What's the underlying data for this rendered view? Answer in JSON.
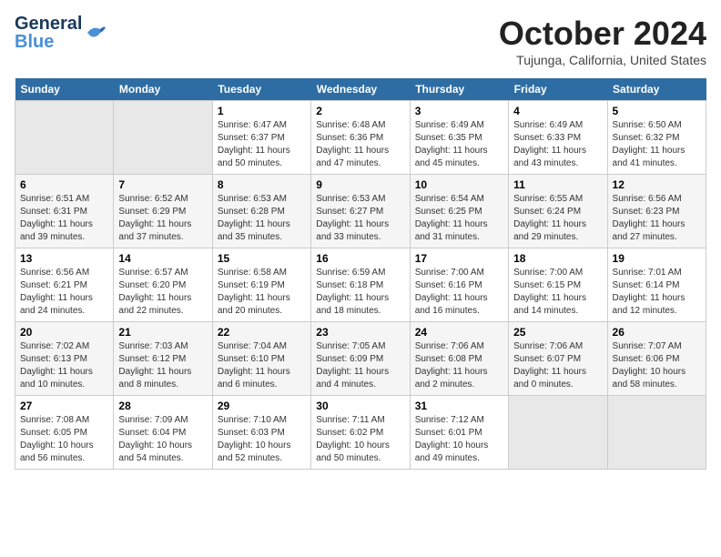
{
  "header": {
    "logo_general": "General",
    "logo_blue": "Blue",
    "month": "October 2024",
    "location": "Tujunga, California, United States"
  },
  "weekdays": [
    "Sunday",
    "Monday",
    "Tuesday",
    "Wednesday",
    "Thursday",
    "Friday",
    "Saturday"
  ],
  "weeks": [
    [
      {
        "day": "",
        "empty": true
      },
      {
        "day": "",
        "empty": true
      },
      {
        "day": "1",
        "sunrise": "6:47 AM",
        "sunset": "6:37 PM",
        "daylight": "11 hours and 50 minutes."
      },
      {
        "day": "2",
        "sunrise": "6:48 AM",
        "sunset": "6:36 PM",
        "daylight": "11 hours and 47 minutes."
      },
      {
        "day": "3",
        "sunrise": "6:49 AM",
        "sunset": "6:35 PM",
        "daylight": "11 hours and 45 minutes."
      },
      {
        "day": "4",
        "sunrise": "6:49 AM",
        "sunset": "6:33 PM",
        "daylight": "11 hours and 43 minutes."
      },
      {
        "day": "5",
        "sunrise": "6:50 AM",
        "sunset": "6:32 PM",
        "daylight": "11 hours and 41 minutes."
      }
    ],
    [
      {
        "day": "6",
        "sunrise": "6:51 AM",
        "sunset": "6:31 PM",
        "daylight": "11 hours and 39 minutes."
      },
      {
        "day": "7",
        "sunrise": "6:52 AM",
        "sunset": "6:29 PM",
        "daylight": "11 hours and 37 minutes."
      },
      {
        "day": "8",
        "sunrise": "6:53 AM",
        "sunset": "6:28 PM",
        "daylight": "11 hours and 35 minutes."
      },
      {
        "day": "9",
        "sunrise": "6:53 AM",
        "sunset": "6:27 PM",
        "daylight": "11 hours and 33 minutes."
      },
      {
        "day": "10",
        "sunrise": "6:54 AM",
        "sunset": "6:25 PM",
        "daylight": "11 hours and 31 minutes."
      },
      {
        "day": "11",
        "sunrise": "6:55 AM",
        "sunset": "6:24 PM",
        "daylight": "11 hours and 29 minutes."
      },
      {
        "day": "12",
        "sunrise": "6:56 AM",
        "sunset": "6:23 PM",
        "daylight": "11 hours and 27 minutes."
      }
    ],
    [
      {
        "day": "13",
        "sunrise": "6:56 AM",
        "sunset": "6:21 PM",
        "daylight": "11 hours and 24 minutes."
      },
      {
        "day": "14",
        "sunrise": "6:57 AM",
        "sunset": "6:20 PM",
        "daylight": "11 hours and 22 minutes."
      },
      {
        "day": "15",
        "sunrise": "6:58 AM",
        "sunset": "6:19 PM",
        "daylight": "11 hours and 20 minutes."
      },
      {
        "day": "16",
        "sunrise": "6:59 AM",
        "sunset": "6:18 PM",
        "daylight": "11 hours and 18 minutes."
      },
      {
        "day": "17",
        "sunrise": "7:00 AM",
        "sunset": "6:16 PM",
        "daylight": "11 hours and 16 minutes."
      },
      {
        "day": "18",
        "sunrise": "7:00 AM",
        "sunset": "6:15 PM",
        "daylight": "11 hours and 14 minutes."
      },
      {
        "day": "19",
        "sunrise": "7:01 AM",
        "sunset": "6:14 PM",
        "daylight": "11 hours and 12 minutes."
      }
    ],
    [
      {
        "day": "20",
        "sunrise": "7:02 AM",
        "sunset": "6:13 PM",
        "daylight": "11 hours and 10 minutes."
      },
      {
        "day": "21",
        "sunrise": "7:03 AM",
        "sunset": "6:12 PM",
        "daylight": "11 hours and 8 minutes."
      },
      {
        "day": "22",
        "sunrise": "7:04 AM",
        "sunset": "6:10 PM",
        "daylight": "11 hours and 6 minutes."
      },
      {
        "day": "23",
        "sunrise": "7:05 AM",
        "sunset": "6:09 PM",
        "daylight": "11 hours and 4 minutes."
      },
      {
        "day": "24",
        "sunrise": "7:06 AM",
        "sunset": "6:08 PM",
        "daylight": "11 hours and 2 minutes."
      },
      {
        "day": "25",
        "sunrise": "7:06 AM",
        "sunset": "6:07 PM",
        "daylight": "11 hours and 0 minutes."
      },
      {
        "day": "26",
        "sunrise": "7:07 AM",
        "sunset": "6:06 PM",
        "daylight": "10 hours and 58 minutes."
      }
    ],
    [
      {
        "day": "27",
        "sunrise": "7:08 AM",
        "sunset": "6:05 PM",
        "daylight": "10 hours and 56 minutes."
      },
      {
        "day": "28",
        "sunrise": "7:09 AM",
        "sunset": "6:04 PM",
        "daylight": "10 hours and 54 minutes."
      },
      {
        "day": "29",
        "sunrise": "7:10 AM",
        "sunset": "6:03 PM",
        "daylight": "10 hours and 52 minutes."
      },
      {
        "day": "30",
        "sunrise": "7:11 AM",
        "sunset": "6:02 PM",
        "daylight": "10 hours and 50 minutes."
      },
      {
        "day": "31",
        "sunrise": "7:12 AM",
        "sunset": "6:01 PM",
        "daylight": "10 hours and 49 minutes."
      },
      {
        "day": "",
        "empty": true
      },
      {
        "day": "",
        "empty": true
      }
    ]
  ]
}
